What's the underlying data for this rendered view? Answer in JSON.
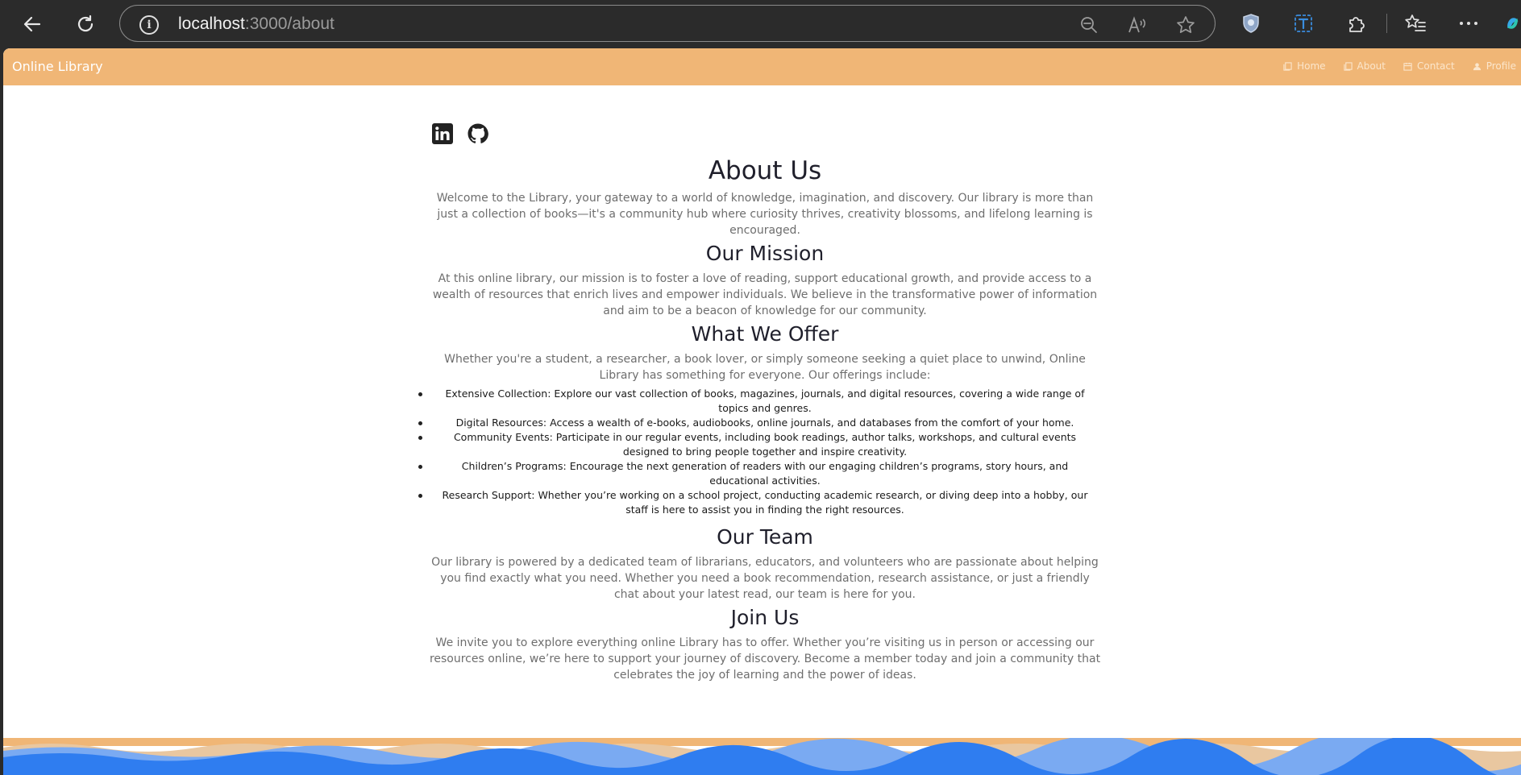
{
  "browser": {
    "url_host": "localhost",
    "url_path": ":3000/about"
  },
  "navbar": {
    "brand": "Online Library",
    "links": [
      {
        "label": "Home",
        "icon": "book-icon"
      },
      {
        "label": "About",
        "icon": "book-icon"
      },
      {
        "label": "Contact",
        "icon": "calendar-icon"
      },
      {
        "label": "Profile",
        "icon": "user-icon"
      }
    ]
  },
  "social": [
    "linkedin-icon",
    "github-icon"
  ],
  "about": {
    "title": "About Us",
    "intro": "Welcome to the Library, your gateway to a world of knowledge, imagination, and discovery. Our library is more than just a collection of books—it's a community hub where curiosity thrives, creativity blossoms, and lifelong learning is encouraged."
  },
  "mission": {
    "title": "Our Mission",
    "text": "At this online library, our mission is to foster a love of reading, support educational growth, and provide access to a wealth of resources that enrich lives and empower individuals. We believe in the transformative power of information and aim to be a beacon of knowledge for our community."
  },
  "offer": {
    "title": "What We Offer",
    "text": "Whether you're a student, a researcher, a book lover, or simply someone seeking a quiet place to unwind, Online Library has something for everyone. Our offerings include:",
    "items": [
      "Extensive Collection: Explore our vast collection of books, magazines, journals, and digital resources, covering a wide range of topics and genres.",
      "Digital Resources: Access a wealth of e-books, audiobooks, online journals, and databases from the comfort of your home.",
      "Community Events: Participate in our regular events, including book readings, author talks, workshops, and cultural events designed to bring people together and inspire creativity.",
      "Children’s Programs: Encourage the next generation of readers with our engaging children’s programs, story hours, and educational activities.",
      "Research Support: Whether you’re working on a school project, conducting academic research, or diving deep into a hobby, our staff is here to assist you in finding the right resources."
    ]
  },
  "team": {
    "title": "Our Team",
    "text": "Our library is powered by a dedicated team of librarians, educators, and volunteers who are passionate about helping you find exactly what you need. Whether you need a book recommendation, research assistance, or just a friendly chat about your latest read, our team is here for you."
  },
  "join": {
    "title": "Join Us",
    "text": "We invite you to explore everything online Library has to offer. Whether you’re visiting us in person or accessing our resources online, we’re here to support your journey of discovery. Become a member today and join a community that celebrates the joy of learning and the power of ideas."
  },
  "colors": {
    "navbar": "#f0b676",
    "wave_blue": "#2f7df0",
    "wave_light": "#7aaaf2"
  }
}
